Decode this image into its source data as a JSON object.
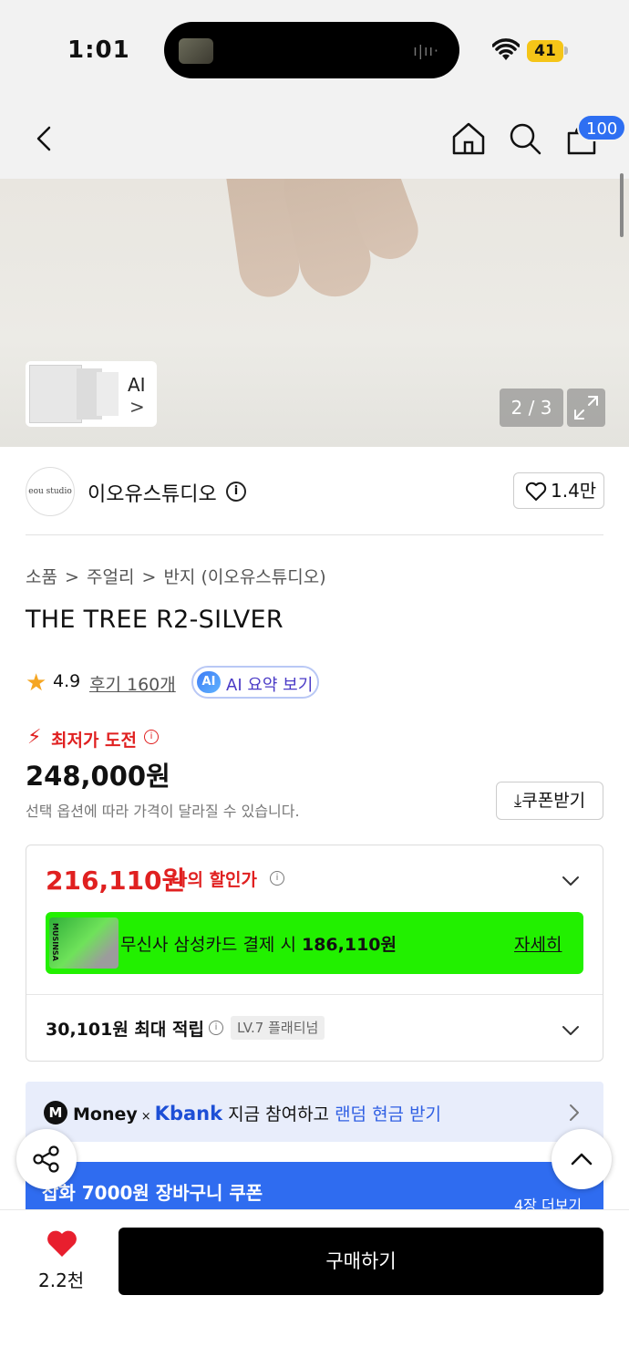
{
  "status_bar": {
    "time": "1:01",
    "battery": "41"
  },
  "header": {
    "cart_count": "100"
  },
  "gallery": {
    "ai_label": "AI",
    "ai_chevron": ">",
    "counter": "2 / 3"
  },
  "brand": {
    "logo_text": "eou studio",
    "name": "이오유스튜디오",
    "info_symbol": "i",
    "likes": "1.4만"
  },
  "breadcrumb": [
    "소품",
    ">",
    "주얼리",
    ">",
    "반지 (이오유스튜디오)"
  ],
  "product": {
    "title": "THE TREE R2-SILVER",
    "rating": "4.9",
    "reviews": "후기 160개",
    "ai_icon": "AI",
    "ai_summary": "AI 요약 보기",
    "lowest_label": "최저가 도전",
    "price": "248,000원",
    "price_note": "선택 옵션에 따라 가격이 달라질 수 있습니다.",
    "coupon": "쿠폰받기"
  },
  "discount": {
    "price": "216,110원",
    "label": "나의 할인가",
    "card_logo": "MUSINSA",
    "card_text_prefix": "무신사 삼성카드 결제 시 ",
    "card_price": "186,110원",
    "card_detail": "자세히",
    "points": "30,101원 최대 적립",
    "level": "LV.7 플래티넘"
  },
  "money_banner": {
    "m_icon": "M",
    "money": "Money",
    "times": "×",
    "kbank": "Kbank",
    "text": " 지금 참여하고 ",
    "highlight": "랜덤 현금 받기"
  },
  "coupon_banner": {
    "text": "잡화 7000원 장바구니 쿠폰",
    "more": "4장 더보기"
  },
  "bottom": {
    "like_count": "2.2천",
    "buy": "구매하기"
  },
  "colors": {
    "accent_red": "#e02020",
    "badge_blue": "#2e6ff2",
    "card_green": "#22f000",
    "coupon_blue": "#2f6cf0"
  },
  "icons": [
    "back-icon",
    "home-icon",
    "search-icon",
    "cart-icon",
    "expand-icon",
    "info-icon",
    "heart-outline-icon",
    "star-icon",
    "lightning-icon",
    "chevron-down-icon",
    "chevron-right-icon",
    "share-icon",
    "arrow-up-icon",
    "heart-filled-icon"
  ]
}
